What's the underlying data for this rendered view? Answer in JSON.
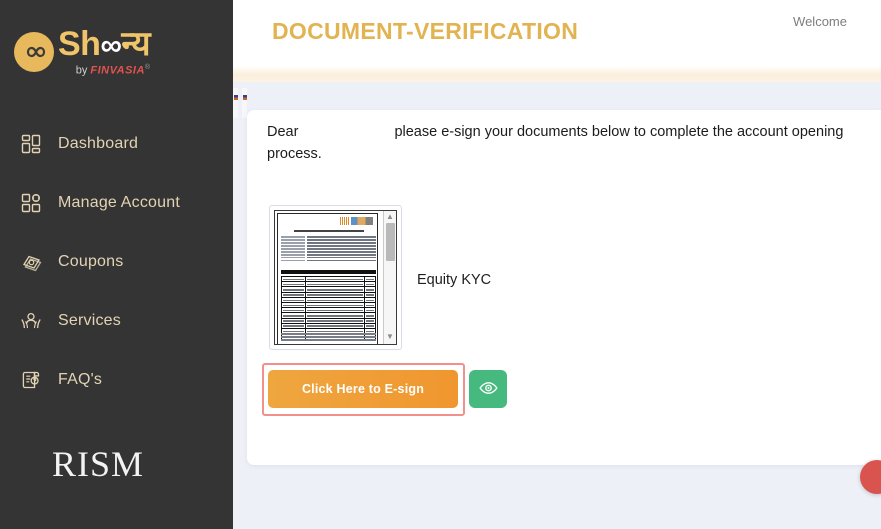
{
  "brand": {
    "word_prefix": "Sh",
    "word_infinity": "∞",
    "word_suffix": "न्य",
    "by_label": "by",
    "company": "FINVASIA",
    "registered_mark": "®"
  },
  "sidebar": {
    "items": [
      {
        "label": "Dashboard",
        "icon": "grid-icon"
      },
      {
        "label": "Manage Account",
        "icon": "manage-account-icon"
      },
      {
        "label": "Coupons",
        "icon": "coupons-icon"
      },
      {
        "label": "Services",
        "icon": "services-icon"
      },
      {
        "label": "FAQ's",
        "icon": "faq-icon"
      }
    ],
    "footer_logo": {
      "text": "RISM",
      "full_name": "PRISM"
    }
  },
  "header": {
    "title": "DOCUMENT-VERIFICATION",
    "welcome": "Welcome"
  },
  "main": {
    "greeting_prefix": "Dear",
    "greeting_body": "please e-sign your documents below to complete the account opening process.",
    "document": {
      "label": "Equity KYC",
      "scroll_up": "▲",
      "scroll_down": "▼"
    },
    "actions": {
      "esign_label": "Click Here to E-sign",
      "view_icon": "eye-icon"
    }
  },
  "colors": {
    "sidebar_bg": "#343434",
    "accent_gold": "#e2b351",
    "nav_text": "#e3d3b4",
    "page_bg": "#eef0f8",
    "esign_orange": "#efa63f",
    "view_green": "#46b97f",
    "highlight_red": "#f2908c",
    "float_red": "#d9534f"
  }
}
